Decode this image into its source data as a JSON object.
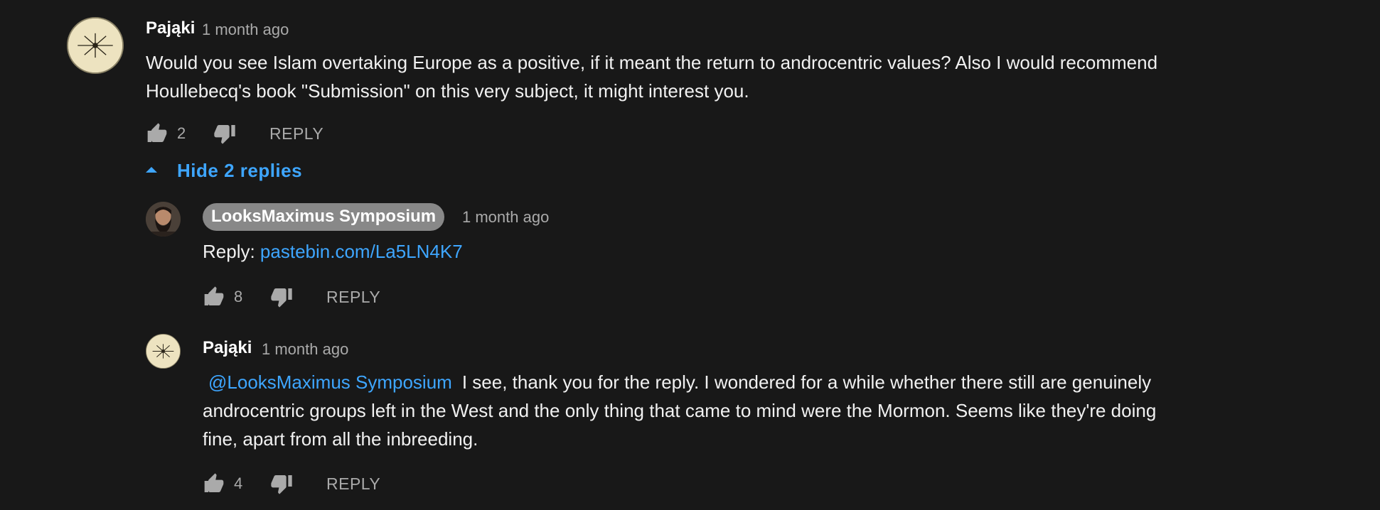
{
  "comment": {
    "author": "Pająki",
    "time": "1 month ago",
    "text_line1": "Would you see Islam overtaking Europe as a positive, if it meant the return to androcentric values? Also I would recommend",
    "text_line2": "Houllebecq's book \"Submission\" on this very subject, it might interest you.",
    "likes": "2",
    "reply_label": "REPLY"
  },
  "replies_toggle": {
    "label": "Hide 2 replies",
    "icon": "caret-up-icon"
  },
  "replies": [
    {
      "author": "LooksMaximus Symposium",
      "time": "1 month ago",
      "text_prefix": "Reply: ",
      "link": "pastebin.com/La5LN4K7",
      "likes": "8",
      "reply_label": "REPLY"
    },
    {
      "author": "Pająki",
      "time": "1 month ago",
      "mention": "@LooksMaximus Symposium",
      "text_line1": "I see, thank you for the reply. I wondered for a while whether there still are genuinely",
      "text_line2": "androcentric groups left in the West and the only thing that came to mind were the Mormon. Seems like they're doing",
      "text_line3": "fine, apart from all the inbreeding.",
      "likes": "4",
      "reply_label": "REPLY"
    }
  ],
  "colors": {
    "background": "#181818",
    "link": "#3ea6ff",
    "muted": "#aaaaaa",
    "badge": "#888888"
  },
  "icons": [
    "thumbs-up-icon",
    "thumbs-down-icon",
    "caret-up-icon"
  ]
}
